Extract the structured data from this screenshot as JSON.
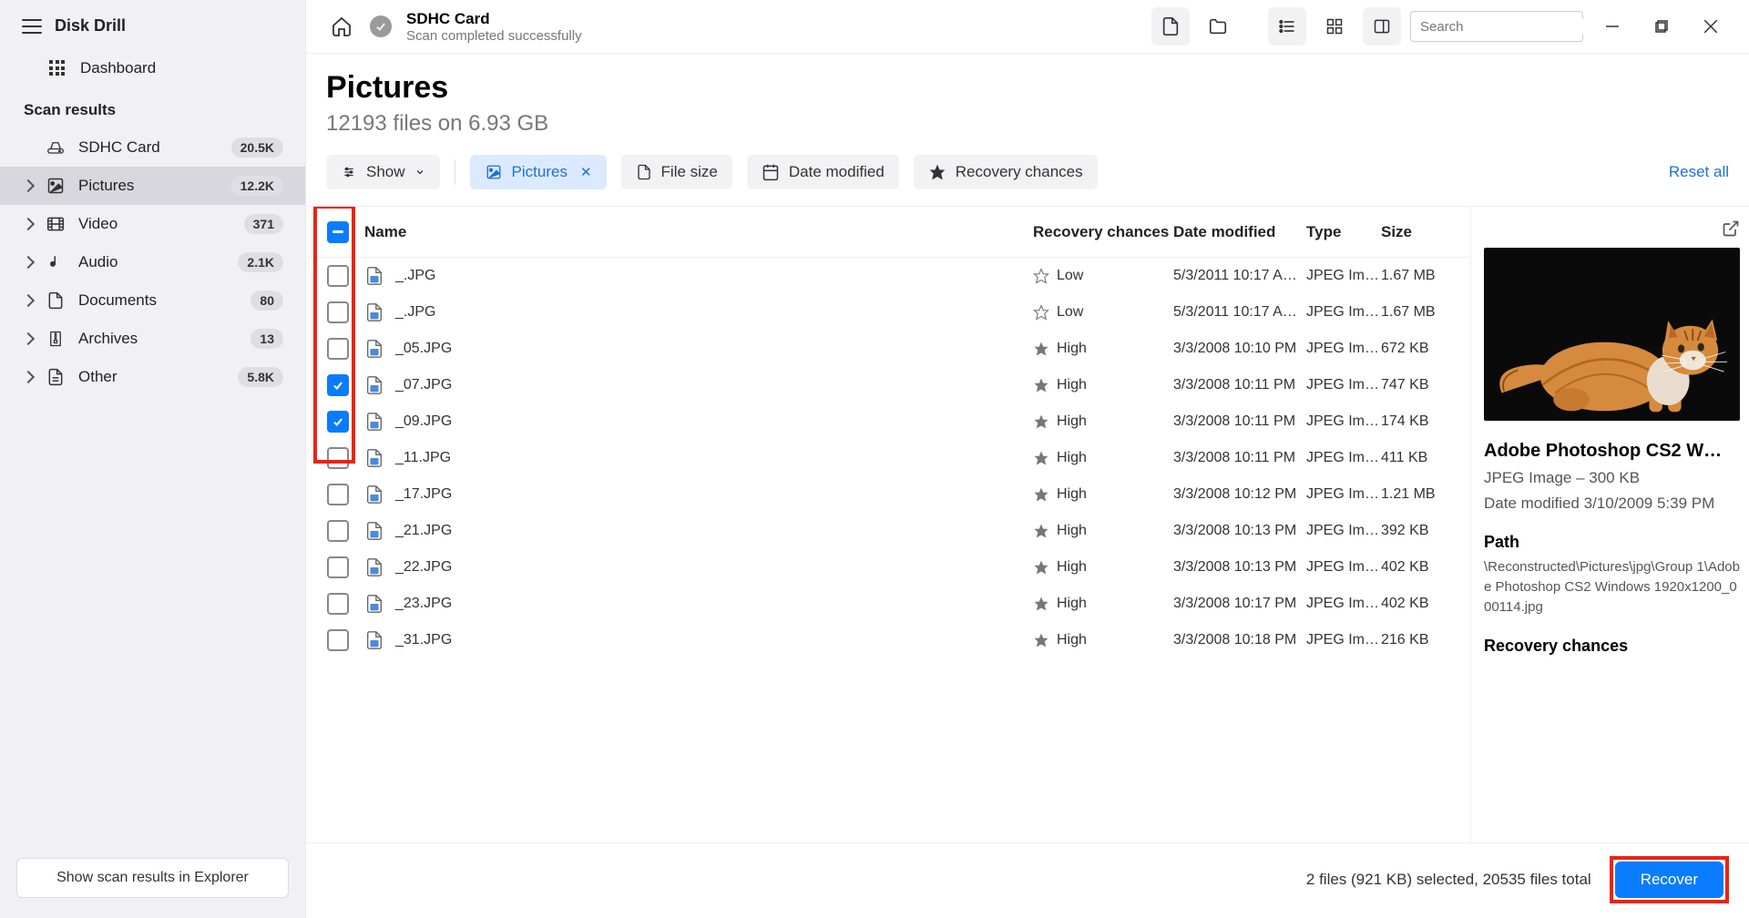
{
  "app": {
    "title": "Disk Drill",
    "dashboard": "Dashboard"
  },
  "scan_results": {
    "title": "Scan results",
    "items": [
      {
        "id": "drive",
        "label": "SDHC Card",
        "badge": "20.5K",
        "active": false,
        "chev": false
      },
      {
        "id": "pictures",
        "label": "Pictures",
        "badge": "12.2K",
        "active": true,
        "chev": true
      },
      {
        "id": "video",
        "label": "Video",
        "badge": "371",
        "active": false,
        "chev": true
      },
      {
        "id": "audio",
        "label": "Audio",
        "badge": "2.1K",
        "active": false,
        "chev": true
      },
      {
        "id": "documents",
        "label": "Documents",
        "badge": "80",
        "active": false,
        "chev": true
      },
      {
        "id": "archives",
        "label": "Archives",
        "badge": "13",
        "active": false,
        "chev": true
      },
      {
        "id": "other",
        "label": "Other",
        "badge": "5.8K",
        "active": false,
        "chev": true
      }
    ]
  },
  "sidebar_footer_btn": "Show scan results in Explorer",
  "topbar": {
    "title": "SDHC Card",
    "subtitle": "Scan completed successfully",
    "search_placeholder": "Search"
  },
  "header": {
    "title": "Pictures",
    "subtitle": "12193 files on 6.93 GB"
  },
  "filters": {
    "show": "Show",
    "pictures": "Pictures",
    "file_size": "File size",
    "date_modified": "Date modified",
    "recovery_chances": "Recovery chances",
    "reset": "Reset all"
  },
  "columns": {
    "name": "Name",
    "recovery": "Recovery chances",
    "date": "Date modified",
    "type": "Type",
    "size": "Size"
  },
  "rows": [
    {
      "checked": false,
      "name": "_.JPG",
      "recovery": "Low",
      "star": false,
      "date": "5/3/2011 10:17 A…",
      "type": "JPEG Im…",
      "size": "1.67 MB"
    },
    {
      "checked": false,
      "name": "_.JPG",
      "recovery": "Low",
      "star": false,
      "date": "5/3/2011 10:17 A…",
      "type": "JPEG Im…",
      "size": "1.67 MB"
    },
    {
      "checked": false,
      "name": "_05.JPG",
      "recovery": "High",
      "star": true,
      "date": "3/3/2008 10:10 PM",
      "type": "JPEG Im…",
      "size": "672 KB"
    },
    {
      "checked": true,
      "name": "_07.JPG",
      "recovery": "High",
      "star": true,
      "date": "3/3/2008 10:11 PM",
      "type": "JPEG Im…",
      "size": "747 KB"
    },
    {
      "checked": true,
      "name": "_09.JPG",
      "recovery": "High",
      "star": true,
      "date": "3/3/2008 10:11 PM",
      "type": "JPEG Im…",
      "size": "174 KB"
    },
    {
      "checked": false,
      "name": "_11.JPG",
      "recovery": "High",
      "star": true,
      "date": "3/3/2008 10:11 PM",
      "type": "JPEG Im…",
      "size": "411 KB"
    },
    {
      "checked": false,
      "name": "_17.JPG",
      "recovery": "High",
      "star": true,
      "date": "3/3/2008 10:12 PM",
      "type": "JPEG Im…",
      "size": "1.21 MB"
    },
    {
      "checked": false,
      "name": "_21.JPG",
      "recovery": "High",
      "star": true,
      "date": "3/3/2008 10:13 PM",
      "type": "JPEG Im…",
      "size": "392 KB"
    },
    {
      "checked": false,
      "name": "_22.JPG",
      "recovery": "High",
      "star": true,
      "date": "3/3/2008 10:13 PM",
      "type": "JPEG Im…",
      "size": "402 KB"
    },
    {
      "checked": false,
      "name": "_23.JPG",
      "recovery": "High",
      "star": true,
      "date": "3/3/2008 10:17 PM",
      "type": "JPEG Im…",
      "size": "402 KB"
    },
    {
      "checked": false,
      "name": "_31.JPG",
      "recovery": "High",
      "star": true,
      "date": "3/3/2008 10:18 PM",
      "type": "JPEG Im…",
      "size": "216 KB"
    }
  ],
  "details": {
    "title": "Adobe Photoshop CS2 W…",
    "subtitle": "JPEG Image – 300 KB",
    "date": "Date modified 3/10/2009 5:39 PM",
    "path_label": "Path",
    "path": "\\Reconstructed\\Pictures\\jpg\\Group 1\\Adobe Photoshop CS2 Windows 1920x1200_000114.jpg",
    "recovery_label": "Recovery chances"
  },
  "footer": {
    "status": "2 files (921 KB) selected, 20535 files total",
    "recover": "Recover"
  }
}
